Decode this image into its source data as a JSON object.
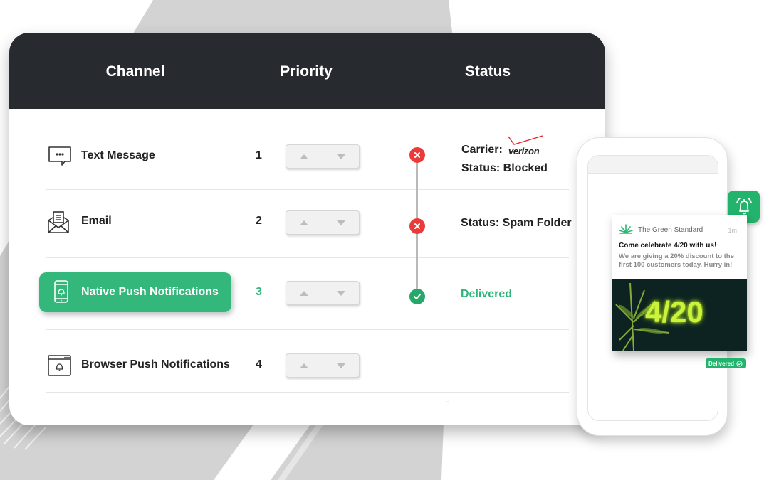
{
  "table": {
    "headers": {
      "channel": "Channel",
      "priority": "Priority",
      "status": "Status"
    },
    "rows": [
      {
        "channel": "Text Message",
        "icon": "chat-bubble-icon",
        "priority": "1",
        "status_icon": "error-x",
        "status_lines": [
          "Carrier:",
          "Status: Blocked"
        ],
        "carrier_logo": "verizon"
      },
      {
        "channel": "Email",
        "icon": "envelope-icon",
        "priority": "2",
        "status_icon": "error-x",
        "status_lines": [
          "Status: Spam Folder"
        ]
      },
      {
        "channel": "Native Push Notifications",
        "icon": "mobile-bell-icon",
        "priority": "3",
        "status_icon": "check",
        "status_lines": [
          "Delivered"
        ],
        "selected": true
      },
      {
        "channel": "Browser Push Notifications",
        "icon": "browser-bell-icon",
        "priority": "4",
        "status_lines": []
      }
    ],
    "footer_mark": "-"
  },
  "phone": {
    "notification": {
      "brand": "The Green Standard",
      "time": "1m",
      "title": "Come celebrate 4/20 with us!",
      "body": "We are giving a 20% discount to the first 100 customers today. Hurry in!",
      "image_text": "4/20"
    },
    "delivered_badge": "Delivered"
  },
  "colors": {
    "header_bg": "#272a2f",
    "accent_green": "#34b77a",
    "error_red": "#ea3a3a",
    "brand_green": "#22b46c"
  }
}
